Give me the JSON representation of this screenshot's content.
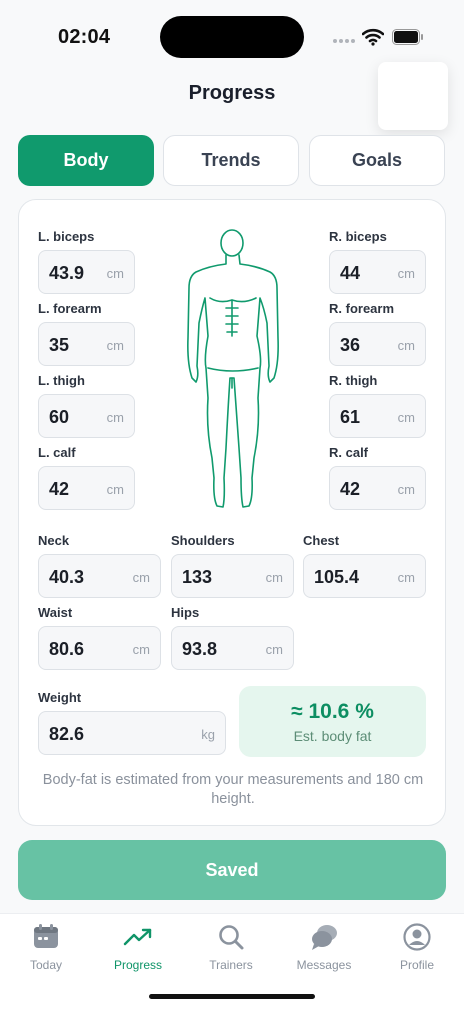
{
  "status": {
    "time": "02:04"
  },
  "header": {
    "title": "Progress"
  },
  "tabs": [
    {
      "label": "Body",
      "active": true
    },
    {
      "label": "Trends",
      "active": false
    },
    {
      "label": "Goals",
      "active": false
    }
  ],
  "measurements": {
    "left_biceps": {
      "label": "L. biceps",
      "value": "43.9",
      "unit": "cm"
    },
    "left_forearm": {
      "label": "L. forearm",
      "value": "35",
      "unit": "cm"
    },
    "left_thigh": {
      "label": "L. thigh",
      "value": "60",
      "unit": "cm"
    },
    "left_calf": {
      "label": "L. calf",
      "value": "42",
      "unit": "cm"
    },
    "right_biceps": {
      "label": "R. biceps",
      "value": "44",
      "unit": "cm"
    },
    "right_forearm": {
      "label": "R. forearm",
      "value": "36",
      "unit": "cm"
    },
    "right_thigh": {
      "label": "R. thigh",
      "value": "61",
      "unit": "cm"
    },
    "right_calf": {
      "label": "R. calf",
      "value": "42",
      "unit": "cm"
    },
    "neck": {
      "label": "Neck",
      "value": "40.3",
      "unit": "cm"
    },
    "shoulders": {
      "label": "Shoulders",
      "value": "133",
      "unit": "cm"
    },
    "chest": {
      "label": "Chest",
      "value": "105.4",
      "unit": "cm"
    },
    "waist": {
      "label": "Waist",
      "value": "80.6",
      "unit": "cm"
    },
    "hips": {
      "label": "Hips",
      "value": "93.8",
      "unit": "cm"
    },
    "weight": {
      "label": "Weight",
      "value": "82.6",
      "unit": "kg"
    }
  },
  "body_fat": {
    "value": "≈ 10.6 %",
    "label": "Est. body fat"
  },
  "footnote": "Body-fat is estimated from your measurements and 180 cm height.",
  "save_button": {
    "label": "Saved"
  },
  "nav": [
    {
      "label": "Today",
      "icon": "calendar-icon",
      "active": false
    },
    {
      "label": "Progress",
      "icon": "trend-icon",
      "active": true
    },
    {
      "label": "Trainers",
      "icon": "search-icon",
      "active": false
    },
    {
      "label": "Messages",
      "icon": "chat-icon",
      "active": false
    },
    {
      "label": "Profile",
      "icon": "profile-icon",
      "active": false
    }
  ],
  "colors": {
    "accent": "#109a6d",
    "accent_light": "#e5f6ee",
    "saved_button": "#67c2a4"
  }
}
